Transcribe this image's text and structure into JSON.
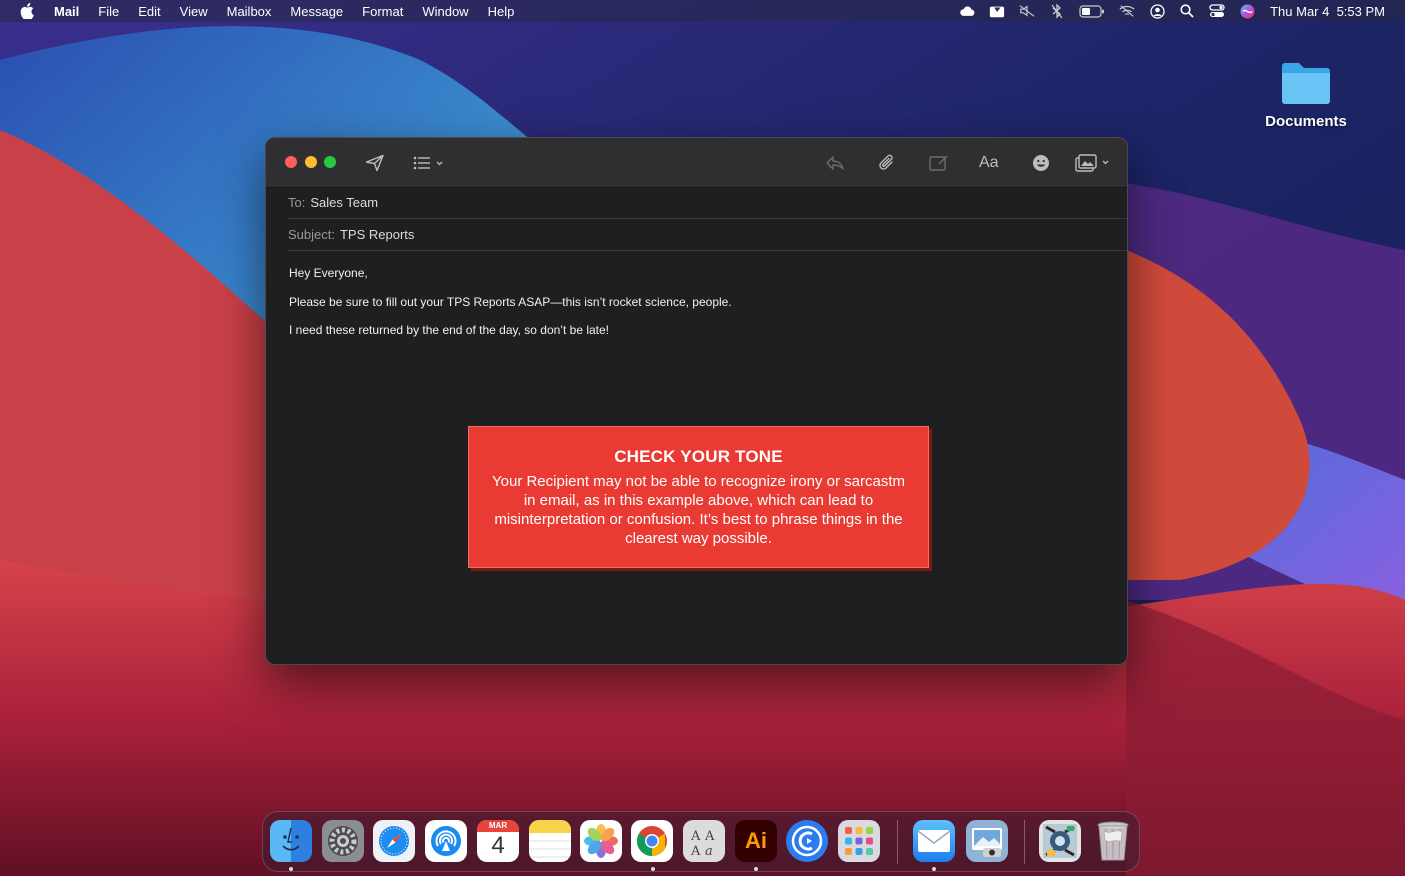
{
  "menubar": {
    "app_name": "Mail",
    "menus": [
      "File",
      "Edit",
      "View",
      "Mailbox",
      "Message",
      "Format",
      "Window",
      "Help"
    ],
    "clock": "Thu Mar 4  5:53 PM",
    "status_icons": [
      "cloud-icon",
      "notes-icon",
      "mute-icon",
      "bluetooth-icon",
      "battery-icon",
      "wifi-icon",
      "user-icon",
      "search-icon",
      "control-center-icon",
      "siri-icon"
    ]
  },
  "desktop": {
    "icons": [
      {
        "label": "Documents",
        "icon": "folder-icon"
      }
    ]
  },
  "compose": {
    "to_label": "To:",
    "to_value": "Sales Team",
    "subject_label": "Subject:",
    "subject_value": "TPS Reports",
    "body": [
      "Hey Everyone,",
      "Please be sure to fill out your TPS Reports ASAP—this isn’t rocket science, people.",
      "I need these returned by the end of the day, so don’t be late!"
    ],
    "toolbar_icons": [
      "send-icon",
      "list-icon",
      "reply-icon",
      "attachment-icon",
      "markup-icon",
      "font-icon",
      "emoji-icon",
      "photo-icon"
    ],
    "font_button_label": "Aa"
  },
  "callout": {
    "title": "CHECK YOUR TONE",
    "text": "Your Recipient may not be able to recognize irony or sarcastm in email, as in this example above, which can lead to misinterpretation or confusion. It’s best to phrase things in the clearest way possible."
  },
  "dock": {
    "apps": [
      "Finder",
      "System Preferences",
      "Safari",
      "AirDrop",
      "Calendar",
      "Notes",
      "Photos",
      "Chrome",
      "Font Book",
      "Illustrator",
      "Screen Recorder",
      "Launchpad",
      "Mail",
      "Preview",
      "Image Capture",
      "Trash"
    ],
    "calendar_month": "MAR",
    "calendar_day": "4",
    "illustrator_label": "Ai"
  },
  "colors": {
    "window_bg": "#1f1e20",
    "callout_bg": "#e93b33",
    "close": "#ff5f57",
    "minimize": "#febc2e",
    "zoom": "#28c840"
  }
}
